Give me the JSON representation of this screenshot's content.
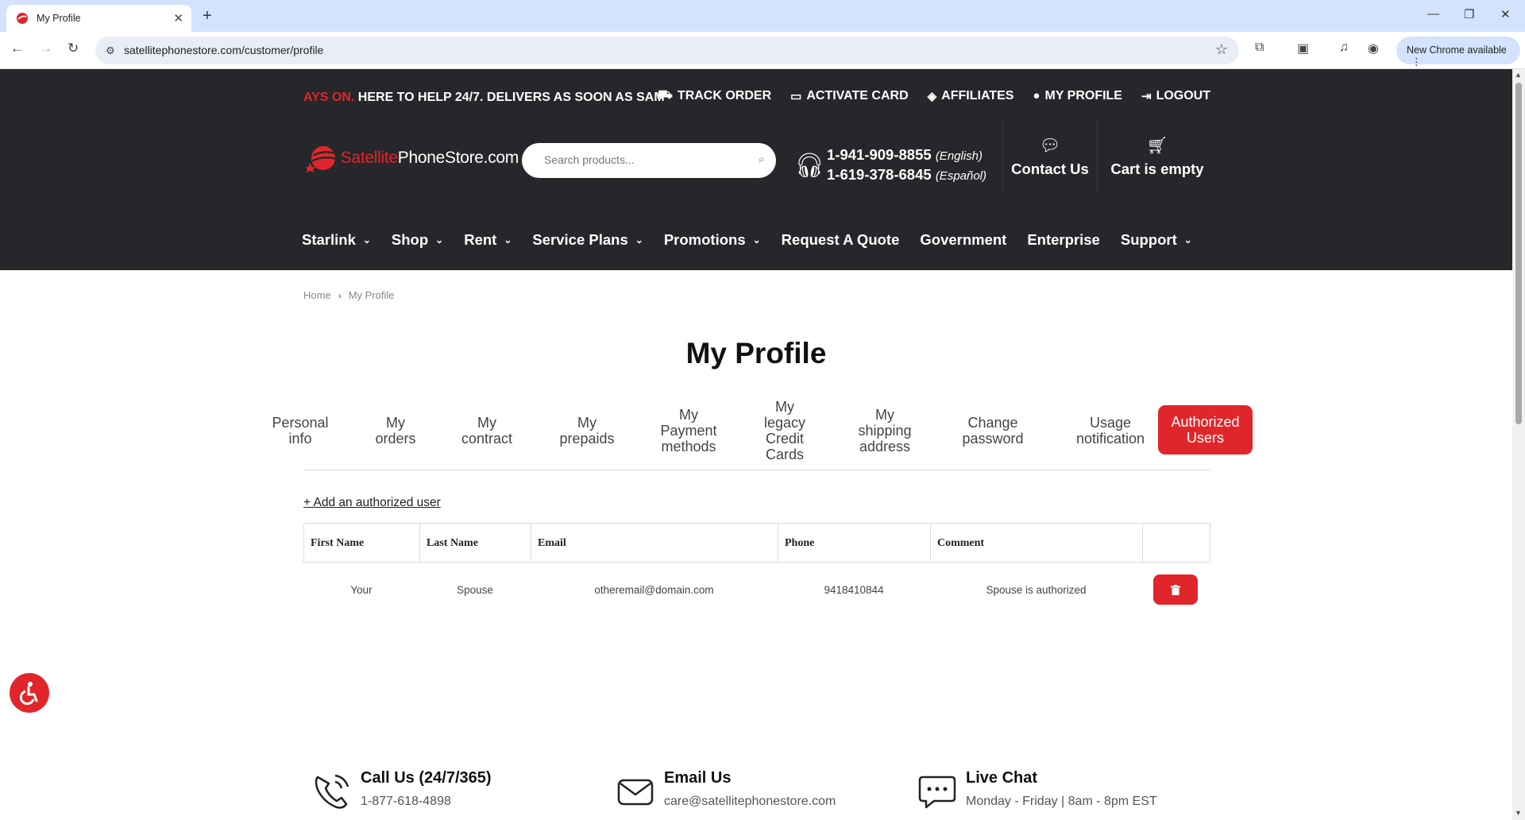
{
  "browser": {
    "tab_title": "My Profile",
    "url": "satellitephonestore.com/customer/profile",
    "new_chrome_label": "New Chrome available"
  },
  "header": {
    "marquee_red": "AYS ON.",
    "marquee_white": "HERE TO HELP 24/7. DELIVERS AS SOON AS SAM",
    "top_links": [
      "TRACK ORDER",
      "ACTIVATE CARD",
      "AFFILIATES",
      "MY PROFILE",
      "LOGOUT"
    ],
    "logo_sat": "Satellite",
    "logo_rest": "PhoneStore.com",
    "search_placeholder": "Search products...",
    "phone_en": "1-941-909-8855",
    "phone_en_lang": "(English)",
    "phone_es": "1-619-378-6845",
    "phone_es_lang": "(Español)",
    "contact_label": "Contact Us",
    "cart_label": "Cart is empty"
  },
  "nav": [
    {
      "label": "Starlink",
      "dropdown": true
    },
    {
      "label": "Shop",
      "dropdown": true
    },
    {
      "label": "Rent",
      "dropdown": true
    },
    {
      "label": "Service Plans",
      "dropdown": true
    },
    {
      "label": "Promotions",
      "dropdown": true
    },
    {
      "label": "Request A Quote",
      "dropdown": false
    },
    {
      "label": "Government",
      "dropdown": false
    },
    {
      "label": "Enterprise",
      "dropdown": false
    },
    {
      "label": "Support",
      "dropdown": true
    }
  ],
  "breadcrumb": {
    "home": "Home",
    "current": "My Profile"
  },
  "page_title": "My Profile",
  "profile_tabs": [
    {
      "label": "Personal\ninfo"
    },
    {
      "label": "My\norders"
    },
    {
      "label": "My\ncontract"
    },
    {
      "label": "My\nprepaids"
    },
    {
      "label": "My\nPayment\nmethods"
    },
    {
      "label": "My\nlegacy\nCredit\nCards"
    },
    {
      "label": "My\nshipping\naddress"
    },
    {
      "label": "Change\npassword"
    },
    {
      "label": "Usage\nnotification"
    },
    {
      "label": "Authorized\nUsers",
      "active": true
    }
  ],
  "add_link": "+ Add an authorized user",
  "table": {
    "headers": [
      "First Name",
      "Last Name",
      "Email",
      "Phone",
      "Comment",
      ""
    ],
    "rows": [
      [
        "Your",
        "Spouse",
        "otheremail@domain.com",
        "9418410844",
        "Spouse is authorized"
      ]
    ]
  },
  "footer": {
    "call_title": "Call Us (24/7/365)",
    "call_sub": "1-877-618-4898",
    "email_title": "Email Us",
    "email_sub": "care@satellitephonestore.com",
    "chat_title": "Live Chat",
    "chat_sub": "Monday - Friday | 8am - 8pm EST"
  },
  "colors": {
    "accent": "#e0262b",
    "header_bg": "#25272a"
  }
}
